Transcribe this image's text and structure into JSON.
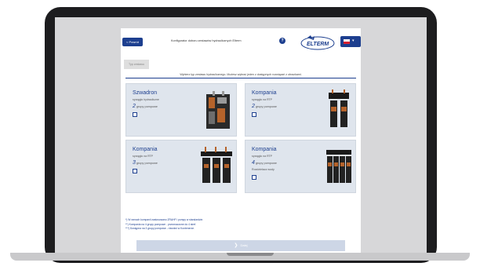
{
  "app": {
    "title": "Konfigurator doboru zestawów hydraulicznych Elterm",
    "back_label": "< Powrót",
    "info_label": "?",
    "logo_text": "ELTERM"
  },
  "tab": {
    "label": "Typ zestawu"
  },
  "instruction": "Wybierz typ zestawu hydraulicznego. Możesz wybrać jeden z dostępnych rozwiązań z obrazkami.",
  "cards": [
    {
      "title": "Szwadron",
      "subtitle": "sprzęgło hydrauliczne",
      "pump_number": "2",
      "pump_text": "grupy pompowe",
      "extra": ""
    },
    {
      "title": "Kompania",
      "subtitle": "sprzęgło na RTP",
      "pump_number": "2",
      "pump_text": "grupy pompowe",
      "extra": ""
    },
    {
      "title": "Kompania",
      "subtitle": "sprzęgło na RTP",
      "pump_number": "3",
      "pump_text": "grupy pompowe",
      "extra": ""
    },
    {
      "title": "Kompania",
      "subtitle": "sprzęgło na RTP",
      "pump_number": "4",
      "pump_text": "grupy pompowe",
      "extra": "Rozdzielacz wody"
    }
  ],
  "notes": [
    "*) W ramach kompanii zastosowano ZRAHF i pompy w standardzie.",
    "**) Kompania na 4 grupy pompowe - przeznaczone do 4 stref.",
    "***) Dostępna na 3 grupy pompowe - również w Kontenerze."
  ],
  "next_label": "Dalej",
  "colors": {
    "accent": "#1d3f8f",
    "card_bg": "#dfe5ed",
    "device_frame": "#1d1d1f"
  }
}
